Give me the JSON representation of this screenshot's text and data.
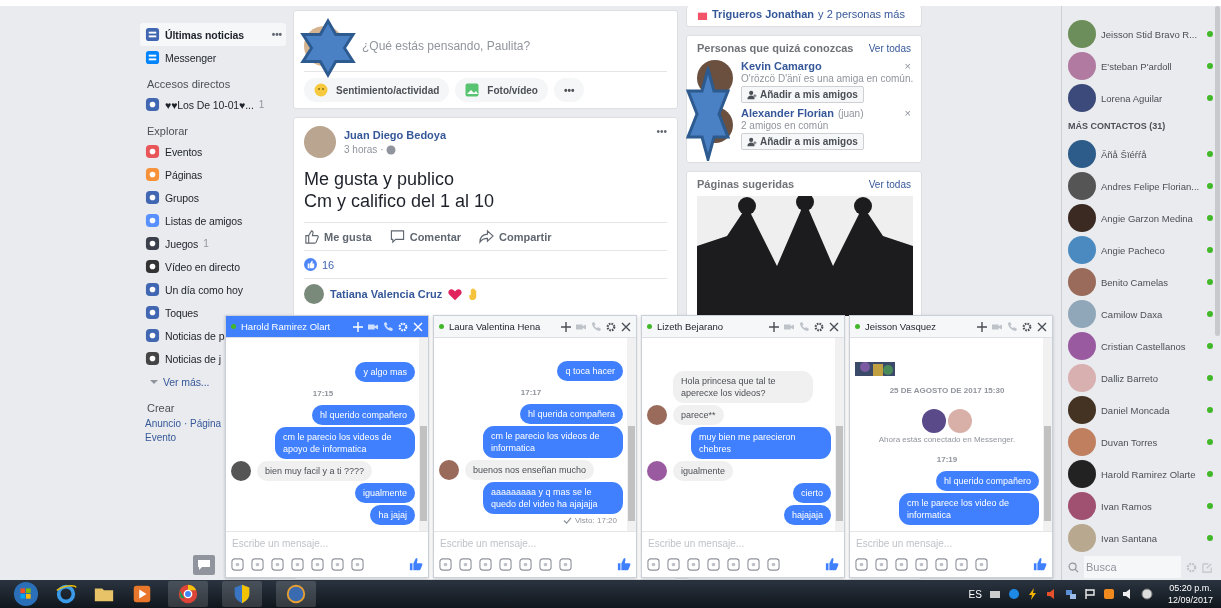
{
  "top_card": {
    "name": "Trigueros Jonathan",
    "suffix": "y 2 personas más"
  },
  "nav": {
    "main": [
      {
        "label": "Últimas noticias",
        "selected": true,
        "more": "•••"
      },
      {
        "label": "Messenger",
        "selected": false
      }
    ],
    "sections": [
      {
        "title": "Accesos directos",
        "items": [
          {
            "label": "♥♥Los De 10-01♥...",
            "count": "1"
          }
        ]
      },
      {
        "title": "Explorar",
        "items": [
          {
            "label": "Eventos"
          },
          {
            "label": "Páginas"
          },
          {
            "label": "Grupos"
          },
          {
            "label": "Listas de amigos"
          },
          {
            "label": "Juegos",
            "count": "1"
          },
          {
            "label": "Vídeo en directo"
          },
          {
            "label": "Un día como hoy"
          },
          {
            "label": "Toques"
          },
          {
            "label": "Noticias de p"
          },
          {
            "label": "Noticias de j"
          }
        ],
        "more": "Ver más..."
      }
    ],
    "create": {
      "title": "Crear",
      "lines": [
        "Anuncio · Página",
        "Evento"
      ]
    }
  },
  "composer": {
    "placeholder": "¿Qué estás pensando, Paulita?",
    "actions": [
      "Sentimiento/actividad",
      "Foto/vídeo",
      "•••"
    ]
  },
  "post": {
    "author": "Juan Diego Bedoya",
    "time": "3 horas ·",
    "more": "•••",
    "text": [
      "Me gusta y publico",
      "Cm y califico del 1 al 10"
    ],
    "actions": [
      "Me gusta",
      "Comentar",
      "Compartir"
    ],
    "likes": "16",
    "comment_author": "Tatiana Valencia Cruz"
  },
  "people": {
    "title": "Personas que quizá conozcas",
    "see_all": "Ver todas",
    "items": [
      {
        "name": "Kevin Camargo",
        "note": "O'rözcö D'änï es una amiga en común.",
        "button": "Añadir a mis amigos",
        "close": "×"
      },
      {
        "name": "Alexander Florian",
        "alias": "(juan)",
        "note": "2 amigos en común",
        "button": "Añadir a mis amigos",
        "close": "×"
      }
    ]
  },
  "pages": {
    "title": "Páginas sugeridas",
    "see_all": "Ver todas"
  },
  "chats": [
    {
      "title": "Harold Ramirez Olart",
      "online": true,
      "focused": true,
      "placeholder": "Escribe un mensaje...",
      "messages": [
        {
          "kind": "out",
          "text": "y algo mas"
        },
        {
          "kind": "time",
          "text": "17:15"
        },
        {
          "kind": "out",
          "text": "hl querido compañero"
        },
        {
          "kind": "out",
          "text": "cm le parecio los videos de apoyo de informatica"
        },
        {
          "kind": "in",
          "text": "bien muy facil y a ti ????",
          "avatar": true
        },
        {
          "kind": "out",
          "text": "igualmente"
        },
        {
          "kind": "out",
          "text": "ha jajaj"
        }
      ]
    },
    {
      "title": "Laura Valentina Hena",
      "online": true,
      "focused": false,
      "placeholder": "Escribe un mensaje...",
      "messages": [
        {
          "kind": "out",
          "text": "q toca hacer"
        },
        {
          "kind": "time",
          "text": "17:17"
        },
        {
          "kind": "out",
          "text": "hl querida compañera"
        },
        {
          "kind": "out",
          "text": "cm le parecio los videos de informatica"
        },
        {
          "kind": "in",
          "text": "buenos nos enseñan mucho",
          "avatar": true
        },
        {
          "kind": "out",
          "text": "aaaaaaaaa y q mas  se le quedo del video ha ajajajja"
        },
        {
          "kind": "seen",
          "text": "Visto: 17:20"
        }
      ]
    },
    {
      "title": "Lizeth Bejarano",
      "online": true,
      "focused": false,
      "placeholder": "Escribe un mensaje...",
      "messages": [
        {
          "kind": "in",
          "text": "Hola princesa que tal te aperecxe los videos?",
          "avatar": false
        },
        {
          "kind": "in",
          "text": "parece**",
          "avatar": true
        },
        {
          "kind": "out",
          "text": "muy bien me parecieron chebres"
        },
        {
          "kind": "in",
          "text": "igualmente",
          "avatar": true
        },
        {
          "kind": "out",
          "text": "cierto"
        },
        {
          "kind": "out",
          "text": "hajajaja"
        }
      ]
    },
    {
      "title": "Jeisson Vasquez",
      "online": true,
      "focused": false,
      "placeholder": "Escribe un mensaje...",
      "messages": [
        {
          "kind": "picture"
        },
        {
          "kind": "date",
          "text": "25 DE AGOSTO DE 2017 15:30"
        },
        {
          "kind": "avatars"
        },
        {
          "kind": "system",
          "text": "Ahora estás conectado en Messenger."
        },
        {
          "kind": "time",
          "text": "17:19"
        },
        {
          "kind": "out",
          "text": "hl querido compañero"
        },
        {
          "kind": "out",
          "text": "cm le parece los video de informatica"
        }
      ]
    }
  ],
  "contacts": {
    "top": [
      {
        "name": "Jeisson Stid Bravo R...",
        "online": true
      },
      {
        "name": "E'steban P'ardoll",
        "online": true
      },
      {
        "name": "Lorena Aguilar",
        "online": true
      }
    ],
    "more_title": "MÁS CONTACTOS (31)",
    "more": [
      {
        "name": "Ãñå Šïéŕŕå",
        "online": true
      },
      {
        "name": "Andres Felipe Florian...",
        "online": true
      },
      {
        "name": "Angie Garzon Medina",
        "online": true
      },
      {
        "name": "Angie Pacheco",
        "online": true
      },
      {
        "name": "Benito Camelas",
        "online": true
      },
      {
        "name": "Camilow Daxa",
        "online": true
      },
      {
        "name": "Cristian Castellanos",
        "online": true
      },
      {
        "name": "Dalliz Barreto",
        "online": true
      },
      {
        "name": "Daniel Moncada",
        "online": true
      },
      {
        "name": "Duvan Torres",
        "online": true
      },
      {
        "name": "Harold Ramirez Olarte",
        "online": true
      },
      {
        "name": "Ivan Ramos",
        "online": true
      },
      {
        "name": "Ivan Santana",
        "online": true
      }
    ],
    "search_placeholder": "Busca"
  },
  "taskbar": {
    "language": "ES",
    "time": "05:20 p.m.",
    "date": "12/09/2017"
  }
}
